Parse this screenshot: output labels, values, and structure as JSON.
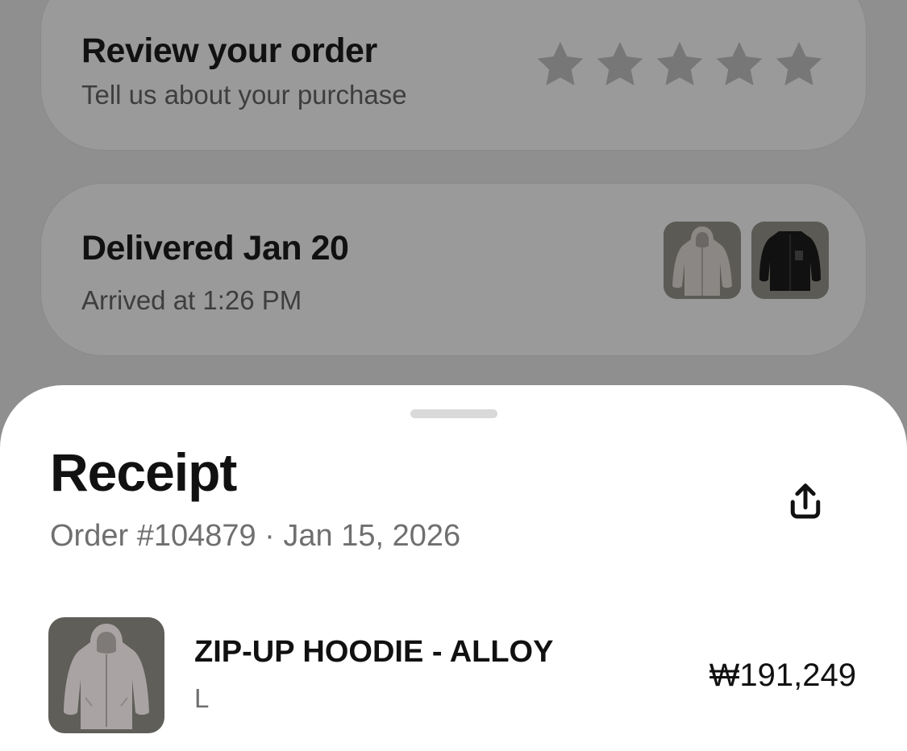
{
  "review_card": {
    "title": "Review your order",
    "subtitle": "Tell us about your purchase",
    "rating": {
      "filled": 0,
      "max": 5
    },
    "star_icon": "star-icon"
  },
  "delivery_card": {
    "title": "Delivered Jan 20",
    "subtitle": "Arrived at 1:26 PM",
    "thumbnails": [
      "hoodie-thumbnail",
      "jacket-thumbnail"
    ]
  },
  "receipt": {
    "title": "Receipt",
    "order_line": "Order #104879 · Jan 15, 2026",
    "share_icon": "share-icon",
    "items": [
      {
        "name": "ZIP-UP HOODIE - ALLOY",
        "variant": "L",
        "price": "₩191,249"
      }
    ]
  },
  "colors": {
    "overlay_background": "#8f8f8f",
    "card_background": "#9a9a9a",
    "sheet_background": "#ffffff",
    "star_color": "#777777",
    "primary_text": "#111111",
    "secondary_text": "#6f6f6f"
  }
}
